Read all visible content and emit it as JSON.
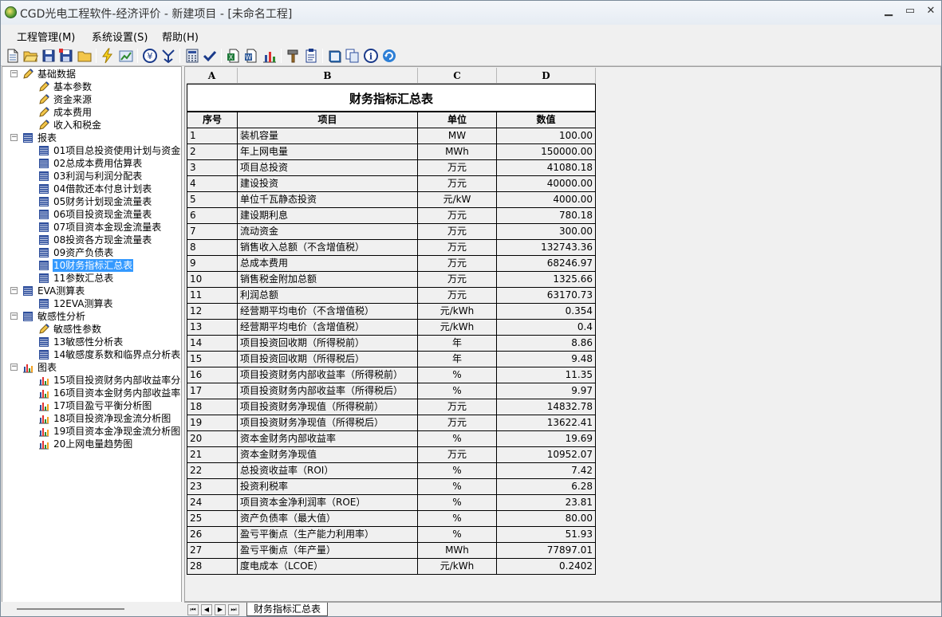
{
  "window": {
    "title": "CGD光电工程软件-经济评价 - 新建项目 - [未命名工程]",
    "minimize": "▁",
    "maximize": "▭",
    "close": "✕"
  },
  "menu": [
    "工程管理(M)",
    "系统设置(S)",
    "帮助(H)"
  ],
  "toolbar_icons": [
    "new-file-icon",
    "open-folder-icon",
    "save-icon",
    "save-as-icon",
    "folder-icon",
    "lightning-icon",
    "chart-arrow-icon",
    "currency-icon",
    "merge-icon",
    "calculator-icon",
    "check-icon",
    "export-excel-icon",
    "export-word-icon",
    "bar-chart-icon",
    "hammer-icon",
    "clipboard-icon",
    "book-icon",
    "copy-icon",
    "info-icon",
    "refresh-icon"
  ],
  "tree": [
    {
      "label": "基础数据",
      "level": 0,
      "icon": "pencil-icon",
      "expander": "−"
    },
    {
      "label": "基本参数",
      "level": 1,
      "icon": "pencil-icon"
    },
    {
      "label": "资金来源",
      "level": 1,
      "icon": "pencil-icon"
    },
    {
      "label": "成本费用",
      "level": 1,
      "icon": "pencil-icon"
    },
    {
      "label": "收入和税金",
      "level": 1,
      "icon": "pencil-icon"
    },
    {
      "label": "报表",
      "level": 0,
      "icon": "table-icon",
      "expander": "−"
    },
    {
      "label": "01项目总投资使用计划与资金筹",
      "level": 1,
      "icon": "table-icon"
    },
    {
      "label": "02总成本费用估算表",
      "level": 1,
      "icon": "table-icon"
    },
    {
      "label": "03利润与利润分配表",
      "level": 1,
      "icon": "table-icon"
    },
    {
      "label": "04借款还本付息计划表",
      "level": 1,
      "icon": "table-icon"
    },
    {
      "label": "05财务计划现金流量表",
      "level": 1,
      "icon": "table-icon"
    },
    {
      "label": "06项目投资现金流量表",
      "level": 1,
      "icon": "table-icon"
    },
    {
      "label": "07项目资本金现金流量表",
      "level": 1,
      "icon": "table-icon"
    },
    {
      "label": "08投资各方现金流量表",
      "level": 1,
      "icon": "table-icon"
    },
    {
      "label": "09资产负债表",
      "level": 1,
      "icon": "table-icon"
    },
    {
      "label": "10财务指标汇总表",
      "level": 1,
      "icon": "table-icon",
      "selected": true
    },
    {
      "label": "11参数汇总表",
      "level": 1,
      "icon": "table-icon"
    },
    {
      "label": "EVA测算表",
      "level": 0,
      "icon": "table-icon",
      "expander": "−"
    },
    {
      "label": "12EVA测算表",
      "level": 1,
      "icon": "table-icon"
    },
    {
      "label": "敏感性分析",
      "level": 0,
      "icon": "table-icon",
      "expander": "−"
    },
    {
      "label": "敏感性参数",
      "level": 1,
      "icon": "pencil-icon"
    },
    {
      "label": "13敏感性分析表",
      "level": 1,
      "icon": "table-icon"
    },
    {
      "label": "14敏感度系数和临界点分析表",
      "level": 1,
      "icon": "table-icon"
    },
    {
      "label": "图表",
      "level": 0,
      "icon": "bar-chart-icon",
      "expander": "−"
    },
    {
      "label": "15项目投资财务内部收益率分析",
      "level": 1,
      "icon": "bar-chart-icon"
    },
    {
      "label": "16项目资本金财务内部收益率分",
      "level": 1,
      "icon": "bar-chart-icon"
    },
    {
      "label": "17项目盈亏平衡分析图",
      "level": 1,
      "icon": "bar-chart-icon"
    },
    {
      "label": "18项目投资净现金流分析图",
      "level": 1,
      "icon": "bar-chart-icon"
    },
    {
      "label": "19项目资本金净现金流分析图",
      "level": 1,
      "icon": "bar-chart-icon"
    },
    {
      "label": "20上网电量趋势图",
      "level": 1,
      "icon": "bar-chart-icon"
    }
  ],
  "sheet": {
    "column_letters": [
      "A",
      "B",
      "C",
      "D"
    ],
    "title": "财务指标汇总表",
    "headers": [
      "序号",
      "项目",
      "单位",
      "数值"
    ],
    "rows": [
      [
        "1",
        "装机容量",
        "MW",
        "100.00"
      ],
      [
        "2",
        "年上网电量",
        "MWh",
        "150000.00"
      ],
      [
        "3",
        "项目总投资",
        "万元",
        "41080.18"
      ],
      [
        "4",
        "建设投资",
        "万元",
        "40000.00"
      ],
      [
        "5",
        "单位千瓦静态投资",
        "元/kW",
        "4000.00"
      ],
      [
        "6",
        "建设期利息",
        "万元",
        "780.18"
      ],
      [
        "7",
        "流动资金",
        "万元",
        "300.00"
      ],
      [
        "8",
        "销售收入总额（不含增值税）",
        "万元",
        "132743.36"
      ],
      [
        "9",
        "总成本费用",
        "万元",
        "68246.97"
      ],
      [
        "10",
        "销售税金附加总额",
        "万元",
        "1325.66"
      ],
      [
        "11",
        "利润总额",
        "万元",
        "63170.73"
      ],
      [
        "12",
        "经营期平均电价（不含增值税）",
        "元/kWh",
        "0.354"
      ],
      [
        "13",
        "经营期平均电价（含增值税）",
        "元/kWh",
        "0.4"
      ],
      [
        "14",
        "项目投资回收期（所得税前）",
        "年",
        "8.86"
      ],
      [
        "15",
        "项目投资回收期（所得税后）",
        "年",
        "9.48"
      ],
      [
        "16",
        "项目投资财务内部收益率（所得税前）",
        "%",
        "11.35"
      ],
      [
        "17",
        "项目投资财务内部收益率（所得税后）",
        "%",
        "9.97"
      ],
      [
        "18",
        "项目投资财务净现值（所得税前）",
        "万元",
        "14832.78"
      ],
      [
        "19",
        "项目投资财务净现值（所得税后）",
        "万元",
        "13622.41"
      ],
      [
        "20",
        "资本金财务内部收益率",
        "%",
        "19.69"
      ],
      [
        "21",
        "资本金财务净现值",
        "万元",
        "10952.07"
      ],
      [
        "22",
        "总投资收益率（ROI）",
        "%",
        "7.42"
      ],
      [
        "23",
        "投资利税率",
        "%",
        "6.28"
      ],
      [
        "24",
        "项目资本金净利润率（ROE）",
        "%",
        "23.81"
      ],
      [
        "25",
        "资产负债率（最大值）",
        "%",
        "80.00"
      ],
      [
        "26",
        "盈亏平衡点（生产能力利用率）",
        "%",
        "51.93"
      ],
      [
        "27",
        "盈亏平衡点（年产量）",
        "MWh",
        "77897.01"
      ],
      [
        "28",
        "度电成本（LCOE）",
        "元/kWh",
        "0.2402"
      ]
    ]
  },
  "sheet_tab": "财务指标汇总表",
  "sheet_nav": [
    "⏮",
    "◀",
    "▶",
    "⏭"
  ]
}
